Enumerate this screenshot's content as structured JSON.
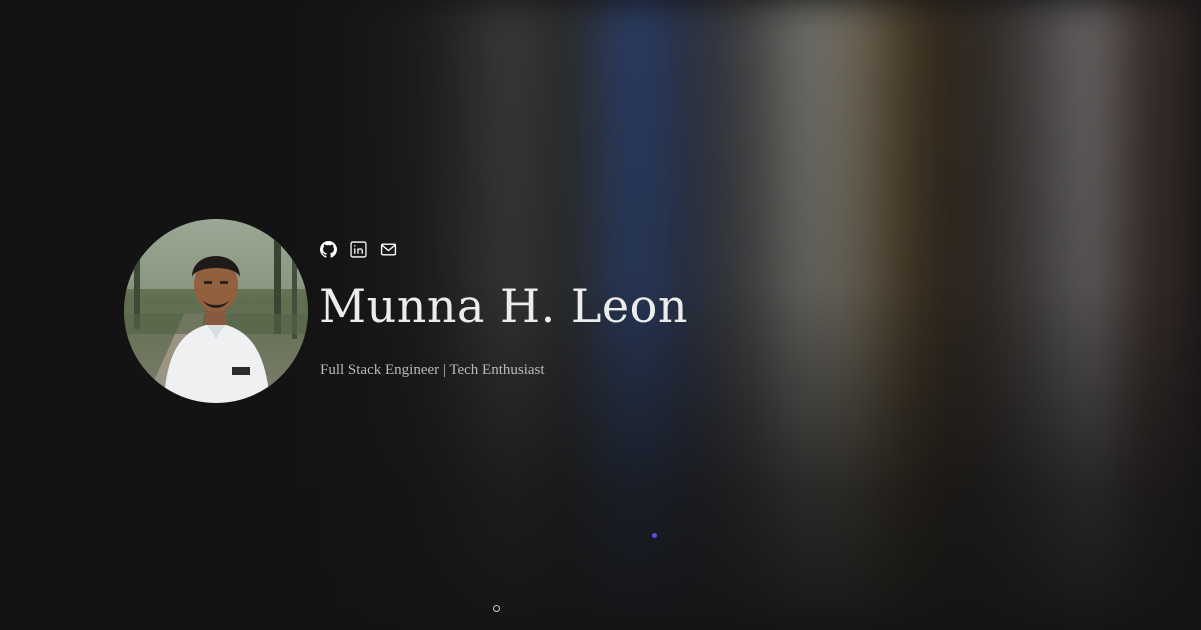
{
  "hero": {
    "name": "Munna H. Leon",
    "tagline": "Full Stack Engineer | Tech Enthusiast"
  },
  "socials": [
    {
      "icon": "github-icon"
    },
    {
      "icon": "linkedin-icon"
    },
    {
      "icon": "mail-icon"
    }
  ],
  "colors": {
    "background": "#131313",
    "name_text": "#ececec",
    "tagline_text": "#b9b9b9",
    "accent_dot": "#5b4fd6"
  }
}
